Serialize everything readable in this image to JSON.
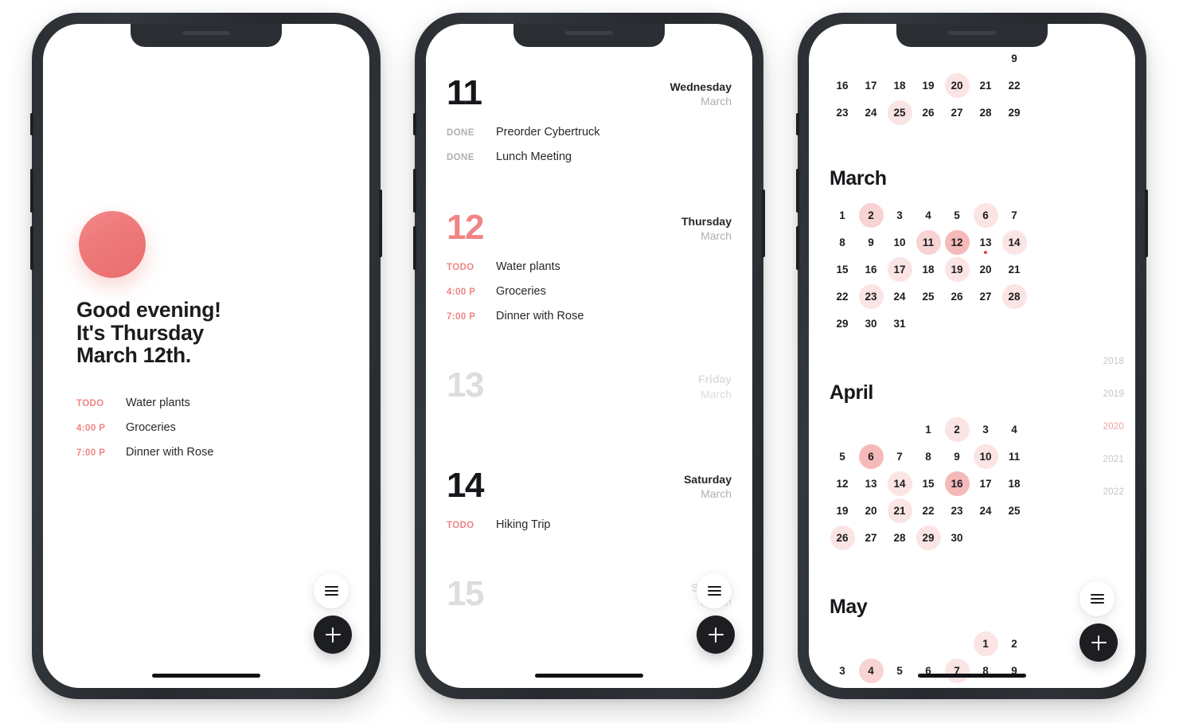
{
  "app": {
    "accent": "#ef7b7b",
    "accent_light": "#fbe4e4",
    "accent_mid": "#f8d3d3",
    "accent_strong": "#f6b9b9",
    "dot_color": "#e8413f",
    "ink": "#1a1c1e",
    "muted": "#adb0b4"
  },
  "screens": [
    {
      "id": "greeting",
      "name": "greeting-screen",
      "greeting_lines": [
        "Good evening!",
        "It's Thursday",
        "March 12th."
      ],
      "tasks": [
        {
          "tag": "TODO",
          "tag_kind": "todo",
          "title": "Water plants"
        },
        {
          "tag": "4:00 P",
          "tag_kind": "todo",
          "title": "Groceries"
        },
        {
          "tag": "7:00 P",
          "tag_kind": "todo",
          "title": "Dinner with Rose"
        }
      ],
      "fab_menu_icon": "hamburger-menu-icon",
      "fab_add_icon": "plus-icon"
    },
    {
      "id": "agenda",
      "name": "agenda-screen",
      "days": [
        {
          "number": "11",
          "weekday": "Wednesday",
          "month": "March",
          "style": "normal",
          "tasks": [
            {
              "tag": "DONE",
              "tag_kind": "done",
              "title": "Preorder Cybertruck"
            },
            {
              "tag": "DONE",
              "tag_kind": "done",
              "title": "Lunch Meeting"
            }
          ]
        },
        {
          "number": "12",
          "weekday": "Thursday",
          "month": "March",
          "style": "accent",
          "tasks": [
            {
              "tag": "TODO",
              "tag_kind": "todo",
              "title": "Water plants"
            },
            {
              "tag": "4:00 P",
              "tag_kind": "todo",
              "title": "Groceries"
            },
            {
              "tag": "7:00 P",
              "tag_kind": "todo",
              "title": "Dinner with Rose"
            }
          ]
        },
        {
          "number": "13",
          "weekday": "Friday",
          "month": "March",
          "style": "muted",
          "tasks": []
        },
        {
          "number": "14",
          "weekday": "Saturday",
          "month": "March",
          "style": "normal",
          "tasks": [
            {
              "tag": "TODO",
              "tag_kind": "todo",
              "title": "Hiking Trip"
            }
          ]
        },
        {
          "number": "15",
          "weekday": "Sunday",
          "month": "March",
          "style": "muted",
          "tasks": []
        }
      ],
      "fab_menu_icon": "hamburger-menu-icon",
      "fab_add_icon": "plus-icon"
    },
    {
      "id": "calendar",
      "name": "calendar-screen",
      "partial_month_top": {
        "rows": [
          [
            {
              "d": "9",
              "h": 0
            }
          ],
          [
            {
              "d": "16",
              "h": 0
            },
            {
              "d": "17",
              "h": 0
            },
            {
              "d": "18",
              "h": 0
            },
            {
              "d": "19",
              "h": 0
            },
            {
              "d": "20",
              "h": 1
            },
            {
              "d": "21",
              "h": 0
            },
            {
              "d": "22",
              "h": 0
            }
          ],
          [
            {
              "d": "23",
              "h": 0
            },
            {
              "d": "24",
              "h": 0
            },
            {
              "d": "25",
              "h": 1
            },
            {
              "d": "26",
              "h": 0
            },
            {
              "d": "27",
              "h": 0
            },
            {
              "d": "28",
              "h": 0
            },
            {
              "d": "29",
              "h": 0
            }
          ]
        ]
      },
      "months": [
        {
          "name": "March",
          "lead_blanks": 0,
          "days": [
            {
              "d": "1",
              "h": 0
            },
            {
              "d": "2",
              "h": 2
            },
            {
              "d": "3",
              "h": 0
            },
            {
              "d": "4",
              "h": 0
            },
            {
              "d": "5",
              "h": 0
            },
            {
              "d": "6",
              "h": 1
            },
            {
              "d": "7",
              "h": 0
            },
            {
              "d": "8",
              "h": 0
            },
            {
              "d": "9",
              "h": 0
            },
            {
              "d": "10",
              "h": 0
            },
            {
              "d": "11",
              "h": 2
            },
            {
              "d": "12",
              "h": 3
            },
            {
              "d": "13",
              "h": 0,
              "dot": true
            },
            {
              "d": "14",
              "h": 1
            },
            {
              "d": "15",
              "h": 0
            },
            {
              "d": "16",
              "h": 0
            },
            {
              "d": "17",
              "h": 1
            },
            {
              "d": "18",
              "h": 0
            },
            {
              "d": "19",
              "h": 1
            },
            {
              "d": "20",
              "h": 0
            },
            {
              "d": "21",
              "h": 0
            },
            {
              "d": "22",
              "h": 0
            },
            {
              "d": "23",
              "h": 1
            },
            {
              "d": "24",
              "h": 0
            },
            {
              "d": "25",
              "h": 0
            },
            {
              "d": "26",
              "h": 0
            },
            {
              "d": "27",
              "h": 0
            },
            {
              "d": "28",
              "h": 1
            },
            {
              "d": "29",
              "h": 0
            },
            {
              "d": "30",
              "h": 0
            },
            {
              "d": "31",
              "h": 0
            }
          ]
        },
        {
          "name": "April",
          "lead_blanks": 3,
          "days": [
            {
              "d": "1",
              "h": 0
            },
            {
              "d": "2",
              "h": 1
            },
            {
              "d": "3",
              "h": 0
            },
            {
              "d": "4",
              "h": 0
            },
            {
              "d": "5",
              "h": 0
            },
            {
              "d": "6",
              "h": 3
            },
            {
              "d": "7",
              "h": 0
            },
            {
              "d": "8",
              "h": 0
            },
            {
              "d": "9",
              "h": 0
            },
            {
              "d": "10",
              "h": 1
            },
            {
              "d": "11",
              "h": 0
            },
            {
              "d": "12",
              "h": 0
            },
            {
              "d": "13",
              "h": 0
            },
            {
              "d": "14",
              "h": 1
            },
            {
              "d": "15",
              "h": 0
            },
            {
              "d": "16",
              "h": 3
            },
            {
              "d": "17",
              "h": 0
            },
            {
              "d": "18",
              "h": 0
            },
            {
              "d": "19",
              "h": 0
            },
            {
              "d": "20",
              "h": 0
            },
            {
              "d": "21",
              "h": 1
            },
            {
              "d": "22",
              "h": 0
            },
            {
              "d": "23",
              "h": 0
            },
            {
              "d": "24",
              "h": 0
            },
            {
              "d": "25",
              "h": 0
            },
            {
              "d": "26",
              "h": 1
            },
            {
              "d": "27",
              "h": 0
            },
            {
              "d": "28",
              "h": 0
            },
            {
              "d": "29",
              "h": 1
            },
            {
              "d": "30",
              "h": 0
            }
          ]
        },
        {
          "name": "May",
          "lead_blanks": 5,
          "days": [
            {
              "d": "1",
              "h": 1
            },
            {
              "d": "2",
              "h": 0
            },
            {
              "d": "3",
              "h": 0
            },
            {
              "d": "4",
              "h": 2
            },
            {
              "d": "5",
              "h": 0
            },
            {
              "d": "6",
              "h": 0
            },
            {
              "d": "7",
              "h": 1
            },
            {
              "d": "8",
              "h": 0
            },
            {
              "d": "9",
              "h": 0
            }
          ]
        }
      ],
      "years": [
        {
          "label": "2018",
          "current": false
        },
        {
          "label": "2019",
          "current": false
        },
        {
          "label": "2020",
          "current": true
        },
        {
          "label": "2021",
          "current": false
        },
        {
          "label": "2022",
          "current": false
        }
      ],
      "fab_menu_icon": "hamburger-menu-icon",
      "fab_add_icon": "plus-icon"
    }
  ]
}
